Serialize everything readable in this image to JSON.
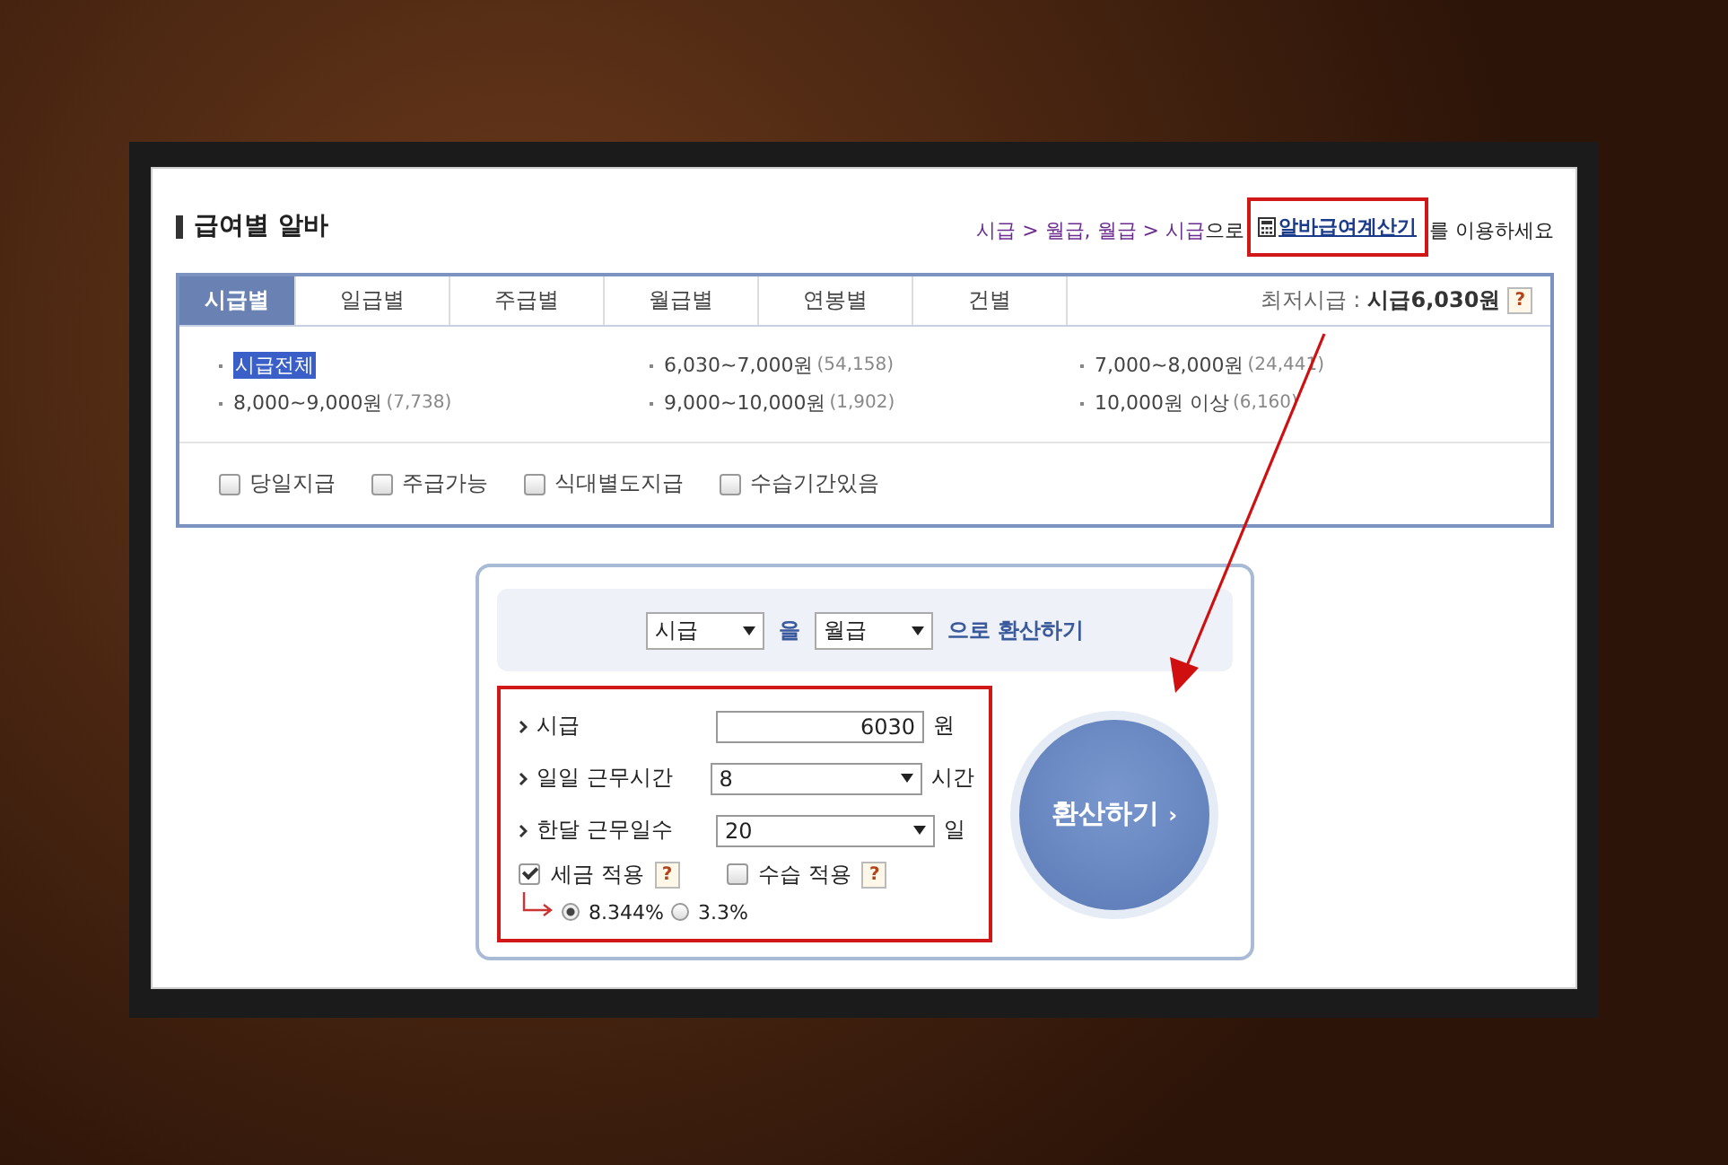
{
  "page_title": "급여별 알바",
  "hint": {
    "path": "시급 > 월급, 월급 > 시급",
    "joiner": "으로",
    "link": "알바급여계산기",
    "link_highlighted": true,
    "tail": "를 이용하세요"
  },
  "tabs": [
    {
      "label": "시급별",
      "selected": true
    },
    {
      "label": "일급별",
      "selected": false
    },
    {
      "label": "주급별",
      "selected": false
    },
    {
      "label": "월급별",
      "selected": false
    },
    {
      "label": "연봉별",
      "selected": false
    },
    {
      "label": "건별",
      "selected": false
    }
  ],
  "min_wage": {
    "label": "최저시급 :",
    "value": "시급6,030원",
    "help": "?"
  },
  "ranges": [
    {
      "label": "시급전체",
      "selected": true
    },
    {
      "label": "6,030~7,000원",
      "count": "(54,158)",
      "selected": false
    },
    {
      "label": "7,000~8,000원",
      "count": "(24,441)",
      "selected": false
    },
    {
      "label": "8,000~9,000원",
      "count": "(7,738)",
      "selected": false
    },
    {
      "label": "9,000~10,000원",
      "count": "(1,902)",
      "selected": false
    },
    {
      "label": "10,000원 이상",
      "count": "(6,160)",
      "selected": false
    }
  ],
  "filters": [
    {
      "label": "당일지급",
      "checked": false
    },
    {
      "label": "주급가능",
      "checked": false
    },
    {
      "label": "식대별도지급",
      "checked": false
    },
    {
      "label": "수습기간있음",
      "checked": false
    }
  ],
  "converter": {
    "from": "시급",
    "particle": "을",
    "to": "월급",
    "suffix": "으로 환산하기"
  },
  "form": {
    "highlighted": true,
    "rows": [
      {
        "kind": "input",
        "label": "시급",
        "value": "6030",
        "unit": "원"
      },
      {
        "kind": "select",
        "label": "일일 근무시간",
        "value": "8",
        "unit": "시간"
      },
      {
        "kind": "select",
        "label": "한달 근무일수",
        "value": "20",
        "unit": "일"
      }
    ],
    "options": [
      {
        "label": "세금 적용",
        "checked": true,
        "help": "?"
      },
      {
        "label": "수습 적용",
        "checked": false,
        "help": "?"
      }
    ],
    "rates": [
      {
        "label": "8.344%",
        "selected": true
      },
      {
        "label": "3.3%",
        "selected": false
      }
    ]
  },
  "convert_button": {
    "label": "환산하기",
    "chevron": "›"
  }
}
